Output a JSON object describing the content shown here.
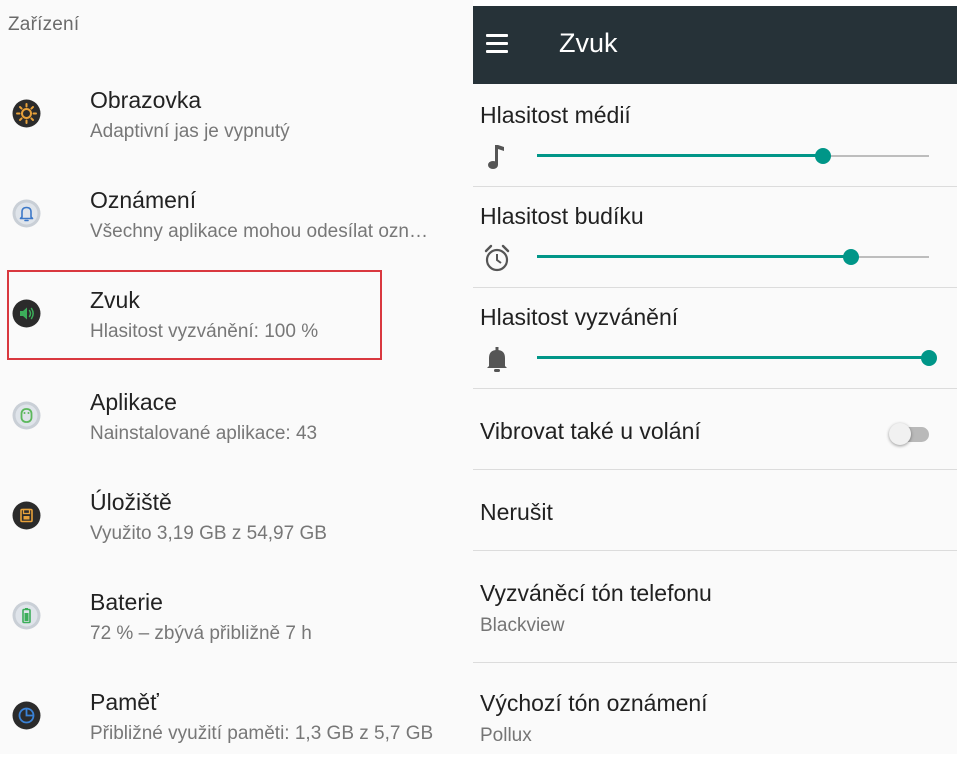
{
  "left": {
    "section_title": "Zařízení",
    "items": [
      {
        "title": "Obrazovka",
        "subtitle": "Adaptivní jas je vypnutý",
        "icon": "brightness-icon",
        "color": "#e8a13a"
      },
      {
        "title": "Oznámení",
        "subtitle": "Všechny aplikace mohou odesílat ozn…",
        "icon": "bell-icon",
        "color": "#5b8fd6"
      },
      {
        "title": "Zvuk",
        "subtitle": "Hlasitost vyzvánění: 100 %",
        "icon": "speaker-icon",
        "color": "#3cae5a",
        "highlighted": true
      },
      {
        "title": "Aplikace",
        "subtitle": "Nainstalované aplikace: 43",
        "icon": "android-icon",
        "color": "#6cc070"
      },
      {
        "title": "Úložiště",
        "subtitle": "Využito 3,19 GB z 54,97 GB",
        "icon": "storage-icon",
        "color": "#e8a13a"
      },
      {
        "title": "Baterie",
        "subtitle": "72 % – zbývá přibližně 7 h",
        "icon": "battery-icon",
        "color": "#3cae5a"
      },
      {
        "title": "Paměť",
        "subtitle": "Přibližné využití paměti: 1,3 GB z 5,7 GB",
        "icon": "memory-icon",
        "color": "#3a82d6"
      }
    ]
  },
  "right": {
    "toolbar_title": "Zvuk",
    "accent_color": "#009688",
    "toolbar_color": "#263238",
    "volumes": [
      {
        "label": "Hlasitost médií",
        "icon": "music-note-icon",
        "level": 0.73
      },
      {
        "label": "Hlasitost budíku",
        "icon": "alarm-icon",
        "level": 0.8
      },
      {
        "label": "Hlasitost vyzvánění",
        "icon": "bell-icon",
        "level": 1.0
      }
    ],
    "vibrate": {
      "label": "Vibrovat také u volání",
      "on": false
    },
    "dnd": {
      "label": "Nerušit"
    },
    "ringtone": {
      "label": "Vyzváněcí tón telefonu",
      "value": "Blackview"
    },
    "notification_tone": {
      "label": "Výchozí tón oznámení",
      "value": "Pollux"
    }
  }
}
